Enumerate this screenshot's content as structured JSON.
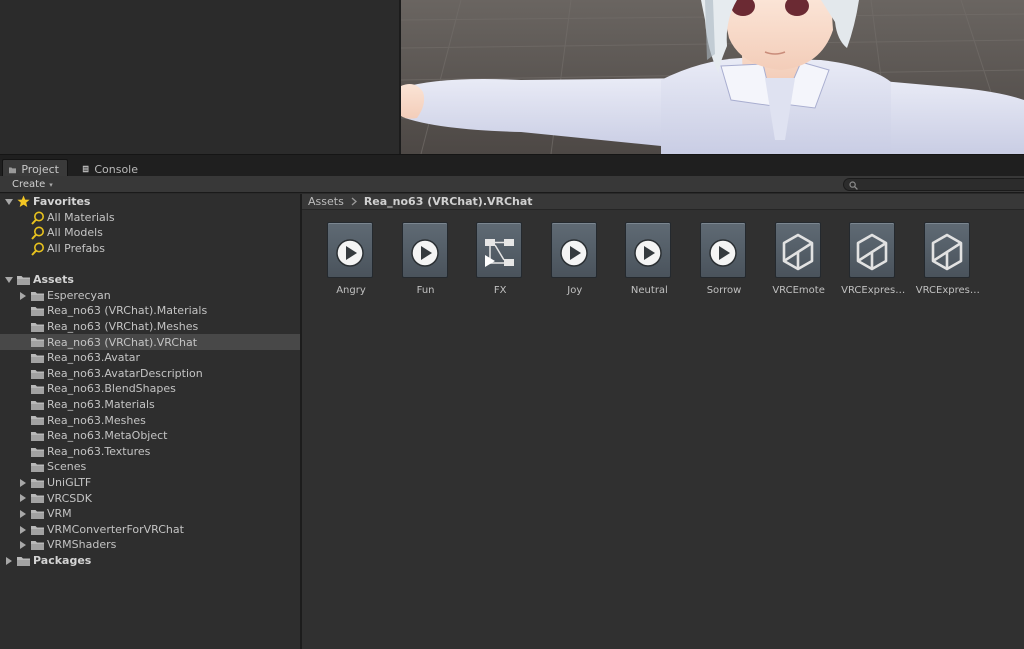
{
  "tabs": [
    {
      "label": "Project",
      "icon": "folder-tab-icon",
      "active": true
    },
    {
      "label": "Console",
      "icon": "console-icon",
      "active": false
    }
  ],
  "toolbar": {
    "create_label": "Create",
    "search_placeholder": ""
  },
  "tree": {
    "favorites": {
      "label": "Favorites",
      "items": [
        "All Materials",
        "All Models",
        "All Prefabs"
      ]
    },
    "assets": {
      "label": "Assets",
      "items": [
        {
          "label": "Esperecyan",
          "expandable": true,
          "selected": false
        },
        {
          "label": "Rea_no63 (VRChat).Materials",
          "expandable": false,
          "selected": false
        },
        {
          "label": "Rea_no63 (VRChat).Meshes",
          "expandable": false,
          "selected": false
        },
        {
          "label": "Rea_no63 (VRChat).VRChat",
          "expandable": false,
          "selected": true
        },
        {
          "label": "Rea_no63.Avatar",
          "expandable": false,
          "selected": false
        },
        {
          "label": "Rea_no63.AvatarDescription",
          "expandable": false,
          "selected": false
        },
        {
          "label": "Rea_no63.BlendShapes",
          "expandable": false,
          "selected": false
        },
        {
          "label": "Rea_no63.Materials",
          "expandable": false,
          "selected": false
        },
        {
          "label": "Rea_no63.Meshes",
          "expandable": false,
          "selected": false
        },
        {
          "label": "Rea_no63.MetaObject",
          "expandable": false,
          "selected": false
        },
        {
          "label": "Rea_no63.Textures",
          "expandable": false,
          "selected": false
        },
        {
          "label": "Scenes",
          "expandable": false,
          "selected": false
        },
        {
          "label": "UniGLTF",
          "expandable": true,
          "selected": false
        },
        {
          "label": "VRCSDK",
          "expandable": true,
          "selected": false
        },
        {
          "label": "VRM",
          "expandable": true,
          "selected": false
        },
        {
          "label": "VRMConverterForVRChat",
          "expandable": true,
          "selected": false
        },
        {
          "label": "VRMShaders",
          "expandable": true,
          "selected": false
        }
      ]
    },
    "packages": {
      "label": "Packages"
    }
  },
  "breadcrumb": {
    "root": "Assets",
    "current": "Rea_no63 (VRChat).VRChat"
  },
  "assets_grid": [
    {
      "label": "Angry",
      "icon": "animation-clip-icon"
    },
    {
      "label": "Fun",
      "icon": "animation-clip-icon"
    },
    {
      "label": "FX",
      "icon": "animator-controller-icon"
    },
    {
      "label": "Joy",
      "icon": "animation-clip-icon"
    },
    {
      "label": "Neutral",
      "icon": "animation-clip-icon"
    },
    {
      "label": "Sorrow",
      "icon": "animation-clip-icon"
    },
    {
      "label": "VRCEmote",
      "icon": "unity-asset-icon"
    },
    {
      "label": "VRCExpres…",
      "icon": "unity-asset-icon"
    },
    {
      "label": "VRCExpres…",
      "icon": "unity-asset-icon"
    }
  ],
  "colors": {
    "panel_bg": "#2e2e2e",
    "selected_row": "#484848",
    "folder": "#b9b9b9",
    "favorite_star": "#f3c623",
    "search_icon": "#e8c21e"
  }
}
